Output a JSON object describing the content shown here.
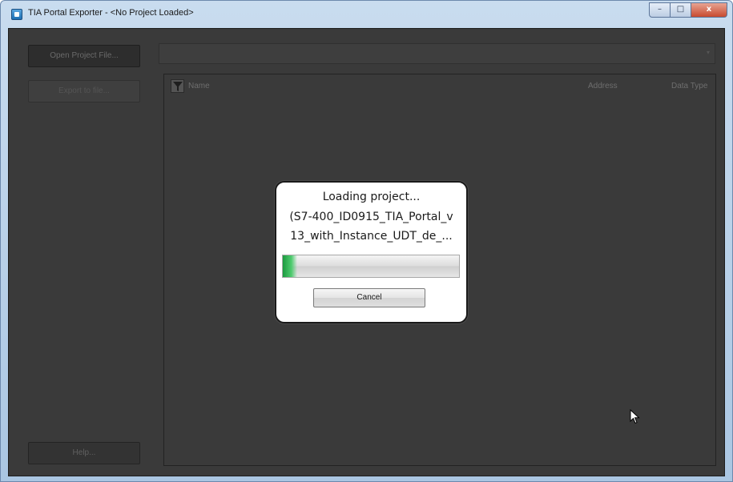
{
  "window": {
    "title": "TIA Portal Exporter - <No Project Loaded>",
    "caption": {
      "minimize": "–",
      "maximize": "□",
      "close": "x"
    }
  },
  "sidebar": {
    "open_label": "Open Project File...",
    "export_label": "Export to file...",
    "help_label": "Help..."
  },
  "path_bar": {
    "value": ""
  },
  "grid": {
    "columns": [
      "Name",
      "Address",
      "Data Type"
    ]
  },
  "dialog": {
    "line1": "Loading project...",
    "line2": "(S7-400_ID0915_TIA_Portal_v",
    "line3": "13_with_Instance_UDT_de_...",
    "progress_fraction": 0.08,
    "cancel_label": "Cancel"
  },
  "icons": {
    "app": "tia-app-icon",
    "filter": "filter-icon",
    "cursor": "mouse-pointer-icon"
  }
}
